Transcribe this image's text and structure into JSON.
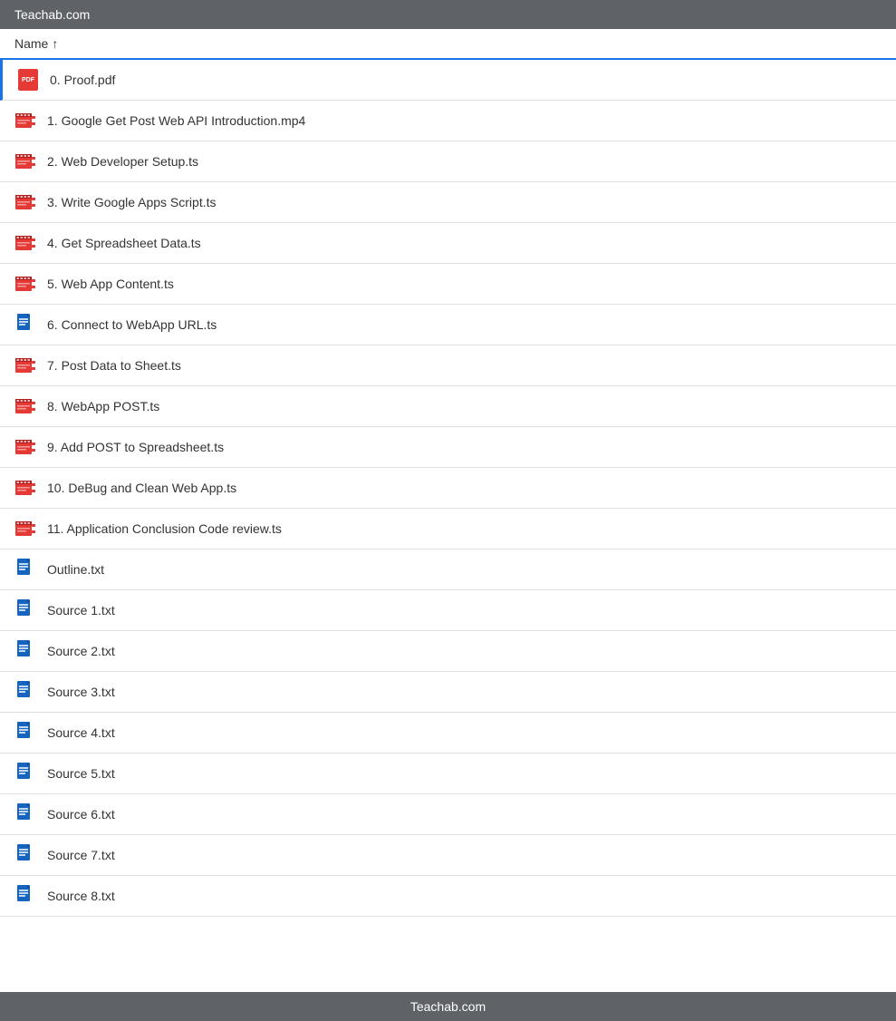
{
  "topBar": {
    "title": "Teachab.com"
  },
  "bottomBar": {
    "title": "Teachab.com"
  },
  "header": {
    "nameLabel": "Name",
    "sortArrow": "↑"
  },
  "files": [
    {
      "id": 1,
      "name": "0. Proof.pdf",
      "type": "pdf",
      "selected": true
    },
    {
      "id": 2,
      "name": "1. Google Get Post Web API Introduction.mp4",
      "type": "video"
    },
    {
      "id": 3,
      "name": "2. Web Developer Setup.ts",
      "type": "video"
    },
    {
      "id": 4,
      "name": "3. Write Google Apps Script.ts",
      "type": "video"
    },
    {
      "id": 5,
      "name": "4. Get Spreadsheet Data.ts",
      "type": "video"
    },
    {
      "id": 6,
      "name": "5. Web App Content.ts",
      "type": "video"
    },
    {
      "id": 7,
      "name": "6. Connect to WebApp URL.ts",
      "type": "doc"
    },
    {
      "id": 8,
      "name": "7. Post Data to Sheet.ts",
      "type": "video"
    },
    {
      "id": 9,
      "name": "8. WebApp POST.ts",
      "type": "video"
    },
    {
      "id": 10,
      "name": "9. Add POST to Spreadsheet.ts",
      "type": "video"
    },
    {
      "id": 11,
      "name": "10. DeBug and Clean Web App.ts",
      "type": "video"
    },
    {
      "id": 12,
      "name": "11. Application Conclusion Code review.ts",
      "type": "video"
    },
    {
      "id": 13,
      "name": "Outline.txt",
      "type": "doc"
    },
    {
      "id": 14,
      "name": "Source 1.txt",
      "type": "doc"
    },
    {
      "id": 15,
      "name": "Source 2.txt",
      "type": "doc"
    },
    {
      "id": 16,
      "name": "Source 3.txt",
      "type": "doc"
    },
    {
      "id": 17,
      "name": "Source 4.txt",
      "type": "doc"
    },
    {
      "id": 18,
      "name": "Source 5.txt",
      "type": "doc"
    },
    {
      "id": 19,
      "name": "Source 6.txt",
      "type": "doc"
    },
    {
      "id": 20,
      "name": "Source 7.txt",
      "type": "doc"
    },
    {
      "id": 21,
      "name": "Source 8.txt",
      "type": "doc"
    }
  ]
}
